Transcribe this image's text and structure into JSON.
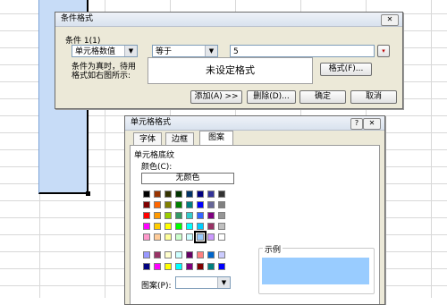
{
  "cond_dialog": {
    "title": "条件格式",
    "close": "✕",
    "condition_label": "条件 1(1)",
    "type_value": "单元格数值",
    "operator_value": "等于",
    "value_input": "5",
    "picker": "▾",
    "hint_line1": "条件为真时，待用",
    "hint_line2": "格式如右图所示:",
    "preview_text": "未设定格式",
    "format_button": "格式(F)...",
    "add_button": "添加(A) >>",
    "delete_button": "删除(D)...",
    "ok_button": "确定",
    "cancel_button": "取消"
  },
  "cell_dialog": {
    "title": "单元格格式",
    "help": "?",
    "close": "✕",
    "tabs": [
      "字体",
      "边框",
      "图案"
    ],
    "shading_group": "单元格底纹",
    "color_label": "颜色(C):",
    "no_color": "无颜色",
    "sample_label": "示例",
    "pattern_label": "图案(P):",
    "sample_color": "#99ccff",
    "selected_color": "#99ccff",
    "palette": [
      [
        "#000000",
        "#993300",
        "#333300",
        "#003300",
        "#003366",
        "#000080",
        "#333399",
        "#333333"
      ],
      [
        "#800000",
        "#ff6600",
        "#808000",
        "#008000",
        "#008080",
        "#0000ff",
        "#666699",
        "#808080"
      ],
      [
        "#ff0000",
        "#ff9900",
        "#99cc00",
        "#339966",
        "#33cccc",
        "#3366ff",
        "#800080",
        "#969696"
      ],
      [
        "#ff00ff",
        "#ffcc00",
        "#ffff00",
        "#00ff00",
        "#00ffff",
        "#00ccff",
        "#993366",
        "#c0c0c0"
      ],
      [
        "#ff99cc",
        "#ffcc99",
        "#ffff99",
        "#ccffcc",
        "#ccffff",
        "#99ccff",
        "#cc99ff",
        "#ffffff"
      ]
    ],
    "palette_extra": [
      [
        "#9999ff",
        "#993366",
        "#ffffcc",
        "#ccffff",
        "#660066",
        "#ff8080",
        "#0066cc",
        "#ccccff"
      ],
      [
        "#000080",
        "#ff00ff",
        "#ffff00",
        "#00ffff",
        "#800080",
        "#800000",
        "#008080",
        "#0000ff"
      ]
    ]
  }
}
